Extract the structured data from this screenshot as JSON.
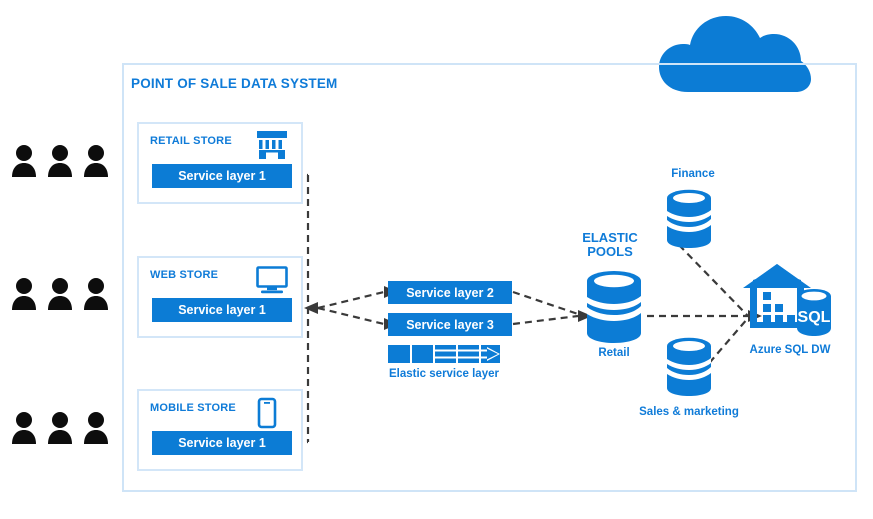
{
  "diagram": {
    "title": "POINT OF SALE DATA SYSTEM",
    "accent_blue": "#0c7cd5",
    "label_blue": "#0f7bd8",
    "frame_blue": "#cfe4f7",
    "people_black": "#0d0d0d",
    "wire_color": "#3a3a3a"
  },
  "clients": [
    {
      "name": "client-group-retail",
      "count": 3
    },
    {
      "name": "client-group-web",
      "count": 3
    },
    {
      "name": "client-group-mobile",
      "count": 3
    }
  ],
  "stores": [
    {
      "title": "RETAIL STORE",
      "icon": "shop-icon",
      "service": "Service layer 1"
    },
    {
      "title": "WEB STORE",
      "icon": "desktop-monitor-icon",
      "service": "Service layer 1"
    },
    {
      "title": "MOBILE STORE",
      "icon": "mobile-phone-icon",
      "service": "Service layer 1"
    }
  ],
  "elastic": {
    "layers": [
      "Service layer 2",
      "Service layer 3"
    ],
    "legend": "Elastic service layer",
    "icon": "elastic-scale-arrow-icon"
  },
  "pools": {
    "heading_line1": "ELASTIC",
    "heading_line2": "POOLS",
    "databases": [
      {
        "label": "Retail",
        "icon": "database-cylinder-icon"
      },
      {
        "label": "Finance",
        "icon": "database-cylinder-icon"
      },
      {
        "label": "Sales & marketing",
        "icon": "database-cylinder-icon"
      }
    ]
  },
  "warehouse": {
    "label": "Azure SQL DW",
    "badge": "SQL",
    "icon": "data-warehouse-icon"
  },
  "cloud": {
    "icon": "cloud-icon"
  }
}
